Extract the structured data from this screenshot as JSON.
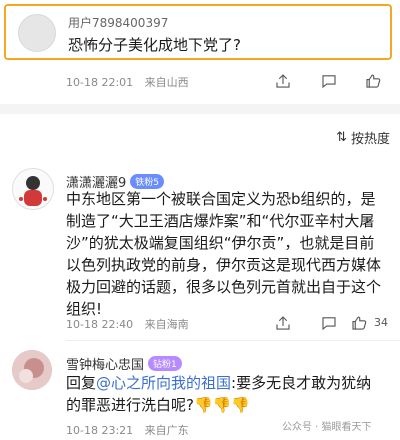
{
  "quote": {
    "username": "用户7898400397",
    "text": "恐怖分子美化成地下党了?"
  },
  "post": {
    "timestamp": "10-18 22:01",
    "location": "来自山西"
  },
  "sort": {
    "label": "按热度"
  },
  "comments": [
    {
      "username": "潇潇灑灑9",
      "badge": "铁粉5",
      "text": "中东地区第一个被联合国定义为恐b组织的，是制造了“大卫王酒店爆炸案”和“代尔亚辛村大屠沙”的犹太极端复国组织“伊尔贡”，也就是目前以色列执政党的前身，伊尔贡这是现代西方媒体极力回避的话题，很多以色列元首就出自于这个组织!",
      "timestamp": "10-18 22:40",
      "location": "来自海南",
      "likes": "34"
    },
    {
      "username": "雪钟梅心忠国",
      "badge": "钻粉1",
      "reply_prefix": "回复",
      "reply_to": "@心之所向我的祖国",
      "text": ":要多无良才敢为犹纳的罪恶进行洗白呢?",
      "thumbs": "👎👎👎",
      "timestamp": "10-18 23:21",
      "location": "来自广东"
    }
  ],
  "watermark": "公众号 · 猫眼看天下"
}
